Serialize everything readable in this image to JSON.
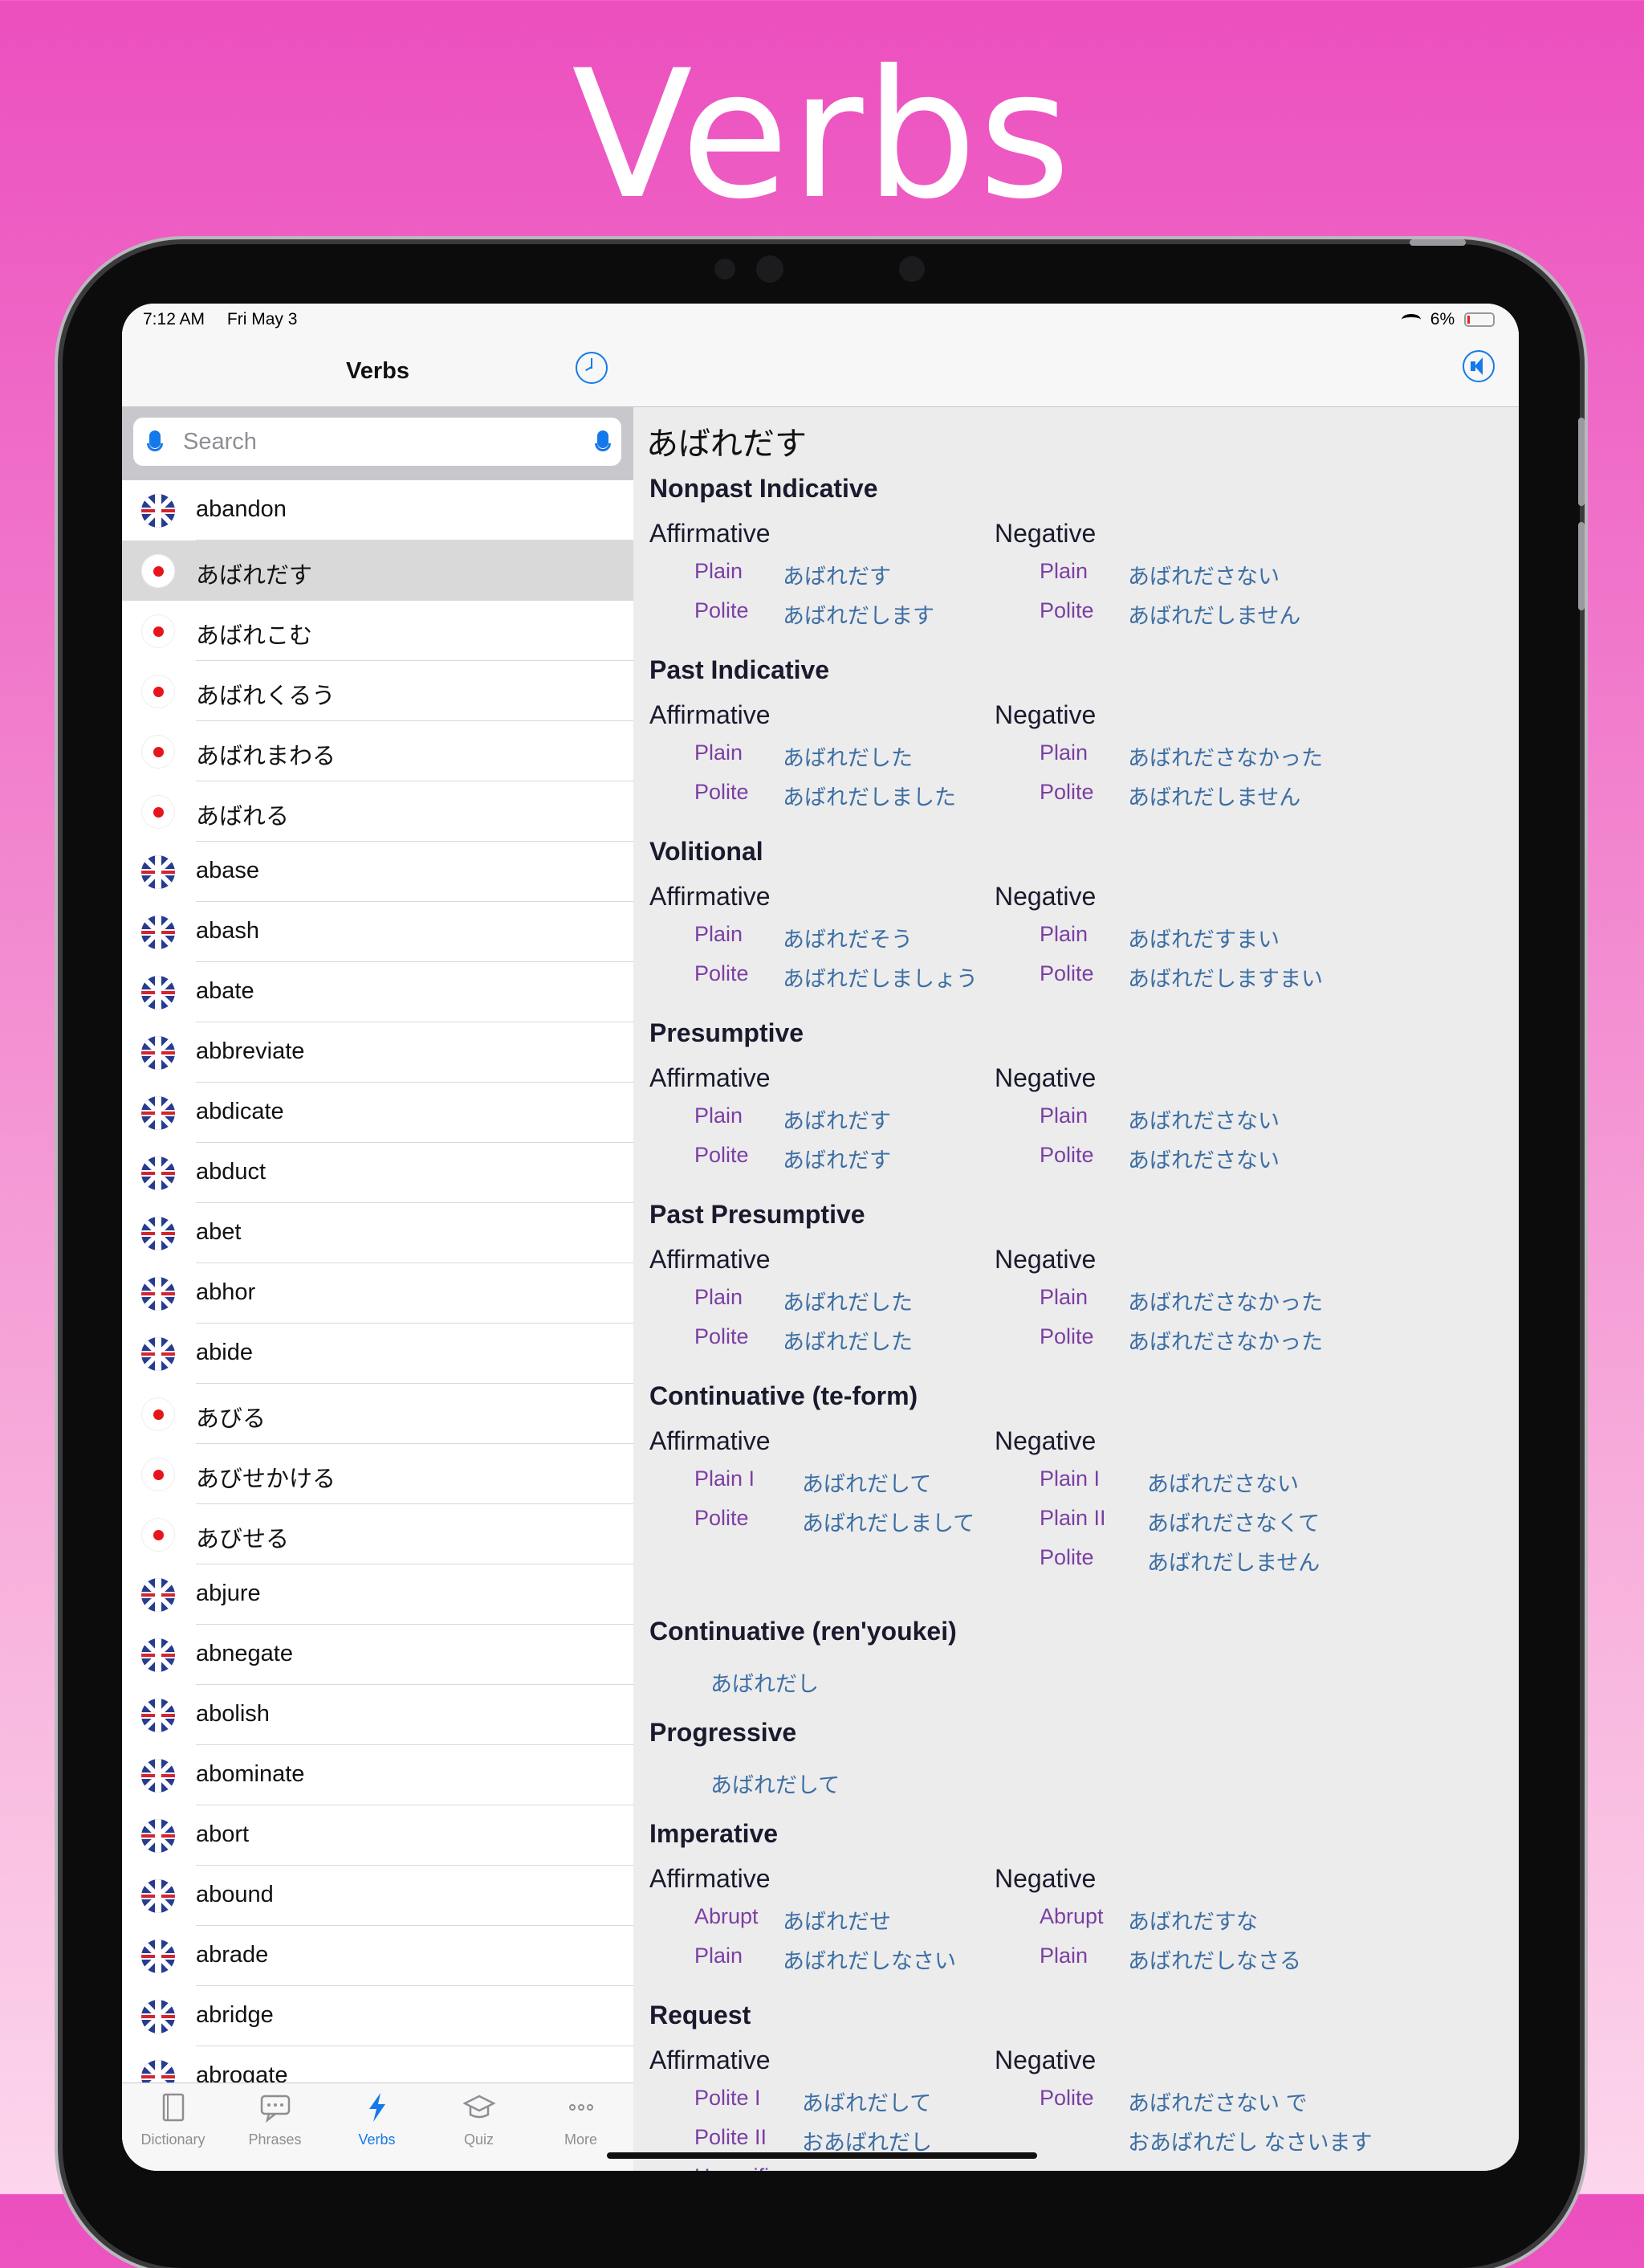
{
  "headline": "Verbs",
  "status": {
    "time": "7:12 AM",
    "date": "Fri May 3",
    "battery": "6%"
  },
  "left": {
    "title": "Verbs",
    "search_placeholder": "Search",
    "items": [
      {
        "label": "abandon",
        "lang": "uk"
      },
      {
        "label": "あばれだす",
        "lang": "jp",
        "selected": true
      },
      {
        "label": "あばれこむ",
        "lang": "jp"
      },
      {
        "label": "あばれくるう",
        "lang": "jp"
      },
      {
        "label": "あばれまわる",
        "lang": "jp"
      },
      {
        "label": "あばれる",
        "lang": "jp"
      },
      {
        "label": "abase",
        "lang": "uk"
      },
      {
        "label": "abash",
        "lang": "uk"
      },
      {
        "label": "abate",
        "lang": "uk"
      },
      {
        "label": "abbreviate",
        "lang": "uk"
      },
      {
        "label": "abdicate",
        "lang": "uk"
      },
      {
        "label": "abduct",
        "lang": "uk"
      },
      {
        "label": "abet",
        "lang": "uk"
      },
      {
        "label": "abhor",
        "lang": "uk"
      },
      {
        "label": "abide",
        "lang": "uk"
      },
      {
        "label": "あびる",
        "lang": "jp"
      },
      {
        "label": "あびせかける",
        "lang": "jp"
      },
      {
        "label": "あびせる",
        "lang": "jp"
      },
      {
        "label": "abjure",
        "lang": "uk"
      },
      {
        "label": "abnegate",
        "lang": "uk"
      },
      {
        "label": "abolish",
        "lang": "uk"
      },
      {
        "label": "abominate",
        "lang": "uk"
      },
      {
        "label": "abort",
        "lang": "uk"
      },
      {
        "label": "abound",
        "lang": "uk"
      },
      {
        "label": "abrade",
        "lang": "uk"
      },
      {
        "label": "abridge",
        "lang": "uk"
      },
      {
        "label": "abrogate",
        "lang": "uk"
      }
    ],
    "tabs": [
      {
        "label": "Dictionary",
        "icon": "book-icon"
      },
      {
        "label": "Phrases",
        "icon": "speech-bubble-icon"
      },
      {
        "label": "Verbs",
        "icon": "lightning-icon",
        "active": true
      },
      {
        "label": "Quiz",
        "icon": "graduation-cap-icon"
      },
      {
        "label": "More",
        "icon": "ellipsis-icon"
      }
    ]
  },
  "detail": {
    "word": "あばれだす",
    "sections": [
      {
        "title": "Nonpast Indicative",
        "aff_title": "Affirmative",
        "neg_title": "Negative",
        "aff": [
          [
            "Plain",
            "あばれだす"
          ],
          [
            "Polite",
            "あばれだします"
          ]
        ],
        "neg": [
          [
            "Plain",
            "あばれださない"
          ],
          [
            "Polite",
            "あばれだしません"
          ]
        ]
      },
      {
        "title": "Past Indicative",
        "aff_title": "Affirmative",
        "neg_title": "Negative",
        "aff": [
          [
            "Plain",
            "あばれだした"
          ],
          [
            "Polite",
            "あばれだしました"
          ]
        ],
        "neg": [
          [
            "Plain",
            "あばれださなかった"
          ],
          [
            "Polite",
            "あばれだしません"
          ]
        ]
      },
      {
        "title": "Volitional",
        "aff_title": "Affirmative",
        "neg_title": "Negative",
        "aff": [
          [
            "Plain",
            "あばれだそう"
          ],
          [
            "Polite",
            "あばれだしましょう"
          ]
        ],
        "neg": [
          [
            "Plain",
            "あばれだすまい"
          ],
          [
            "Polite",
            "あばれだしますまい"
          ]
        ]
      },
      {
        "title": "Presumptive",
        "aff_title": "Affirmative",
        "neg_title": "Negative",
        "aff": [
          [
            "Plain",
            "あばれだす"
          ],
          [
            "Polite",
            "あばれだす"
          ]
        ],
        "neg": [
          [
            "Plain",
            "あばれださない"
          ],
          [
            "Polite",
            "あばれださない"
          ]
        ]
      },
      {
        "title": "Past Presumptive",
        "aff_title": "Affirmative",
        "neg_title": "Negative",
        "aff": [
          [
            "Plain",
            "あばれだした"
          ],
          [
            "Polite",
            "あばれだした"
          ]
        ],
        "neg": [
          [
            "Plain",
            "あばれださなかった"
          ],
          [
            "Polite",
            "あばれださなかった"
          ]
        ]
      },
      {
        "title": "Continuative (te-form)",
        "aff_title": "Affirmative",
        "neg_title": "Negative",
        "aff": [
          [
            "Plain I",
            "あばれだして"
          ],
          [
            "Polite",
            "あばれだしまして"
          ]
        ],
        "neg": [
          [
            "Plain I",
            "あばれださない"
          ],
          [
            "Plain II",
            "あばれださなくて"
          ],
          [
            "Polite",
            "あばれだしません"
          ]
        ]
      },
      {
        "title": "Continuative (ren'youkei)",
        "single": "あばれだし"
      },
      {
        "title": "Progressive",
        "single": "あばれだして"
      },
      {
        "title": "Imperative",
        "aff_title": "Affirmative",
        "neg_title": "Negative",
        "aff": [
          [
            "Abrupt",
            "あばれだせ"
          ],
          [
            "Plain",
            "あばれだしなさい"
          ]
        ],
        "neg": [
          [
            "Abrupt",
            "あばれだすな"
          ],
          [
            "Plain",
            "あばれだしなさる"
          ]
        ]
      },
      {
        "title": "Request",
        "aff_title": "Affirmative",
        "neg_title": "Negative",
        "aff": [
          [
            "Polite I",
            "あばれだして"
          ],
          [
            "Polite II",
            "おあばれだし"
          ],
          [
            "Honorific",
            "おあばれだし"
          ]
        ],
        "neg": [
          [
            "Polite",
            "あばれださない で"
          ],
          [
            "",
            "おあばれだし なさいます"
          ]
        ]
      }
    ]
  },
  "colors": {
    "accent": "#1479ea",
    "label": "#7b3fa3",
    "value": "#3c6ea4",
    "background_top": "#ec4fbf"
  }
}
